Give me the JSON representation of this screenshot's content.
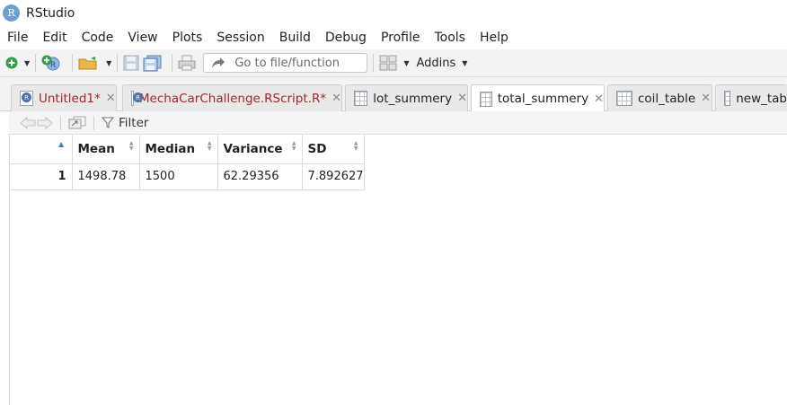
{
  "window": {
    "title": "RStudio",
    "app_icon_letter": "R"
  },
  "menu": [
    "File",
    "Edit",
    "Code",
    "View",
    "Plots",
    "Session",
    "Build",
    "Debug",
    "Profile",
    "Tools",
    "Help"
  ],
  "toolbar": {
    "goto_placeholder": "Go to file/function",
    "addins_label": "Addins"
  },
  "tabs": [
    {
      "label": "Untitled1*",
      "type": "r-script",
      "modified": true,
      "active": false
    },
    {
      "label": "MechaCarChallenge.RScript.R*",
      "type": "r-script",
      "modified": true,
      "active": false
    },
    {
      "label": "lot_summery",
      "type": "data",
      "modified": false,
      "active": false
    },
    {
      "label": "total_summery",
      "type": "data",
      "modified": false,
      "active": true
    },
    {
      "label": "coil_table",
      "type": "data",
      "modified": false,
      "active": false
    },
    {
      "label": "new_tab",
      "type": "data",
      "modified": false,
      "active": false
    }
  ],
  "viewer": {
    "filter_label": "Filter"
  },
  "table": {
    "columns": [
      "Mean",
      "Median",
      "Variance",
      "SD"
    ],
    "rows": [
      {
        "index": "1",
        "cells": [
          "1498.78",
          "1500",
          "62.29356",
          "7.892627"
        ]
      }
    ]
  },
  "colors": {
    "modified_tab_text": "#a5252a",
    "accent": "#3b7fd0"
  }
}
